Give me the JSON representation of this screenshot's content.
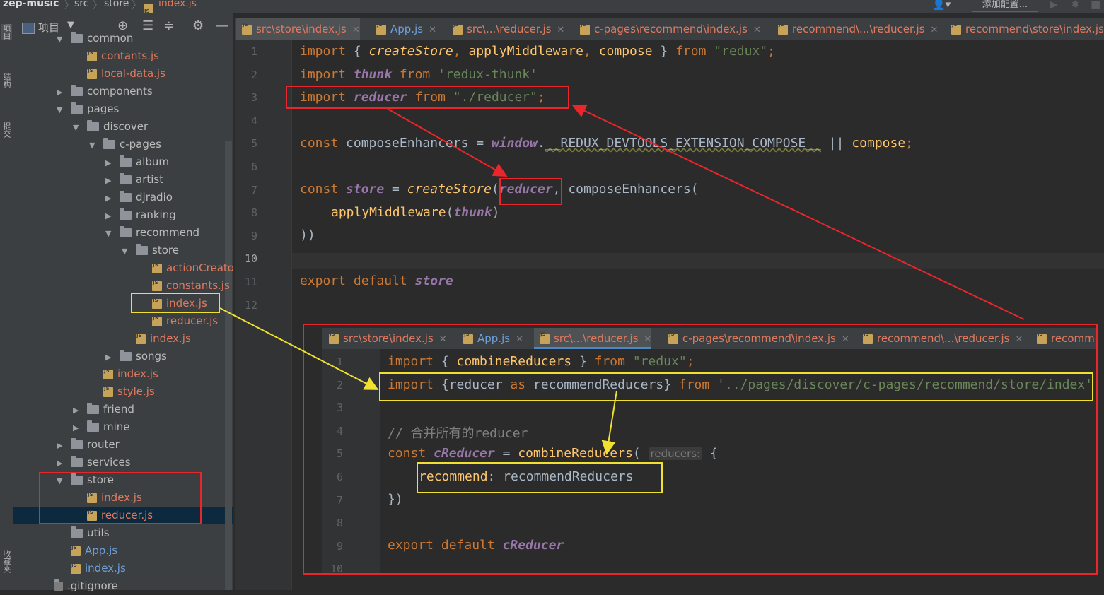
{
  "breadcrumb": {
    "project": "zep-music",
    "items": [
      "src",
      "store"
    ],
    "file": "index.js"
  },
  "toolbar": {
    "add_config": "添加配置..."
  },
  "left_strip": {
    "labels": [
      "项目",
      "结构",
      "提交",
      "收藏夹"
    ]
  },
  "panel": {
    "title": "项目",
    "tree": [
      {
        "label": "common",
        "type": "folder",
        "depth": 3,
        "state": "open"
      },
      {
        "label": "contants.js",
        "type": "js",
        "depth": 4
      },
      {
        "label": "local-data.js",
        "type": "js",
        "depth": 4
      },
      {
        "label": "components",
        "type": "folder",
        "depth": 3,
        "state": "closed"
      },
      {
        "label": "pages",
        "type": "folder",
        "depth": 3,
        "state": "open"
      },
      {
        "label": "discover",
        "type": "folder",
        "depth": 4,
        "state": "open"
      },
      {
        "label": "c-pages",
        "type": "folder",
        "depth": 5,
        "state": "open"
      },
      {
        "label": "album",
        "type": "folder",
        "depth": 6,
        "state": "closed"
      },
      {
        "label": "artist",
        "type": "folder",
        "depth": 6,
        "state": "closed"
      },
      {
        "label": "djradio",
        "type": "folder",
        "depth": 6,
        "state": "closed"
      },
      {
        "label": "ranking",
        "type": "folder",
        "depth": 6,
        "state": "closed"
      },
      {
        "label": "recommend",
        "type": "folder",
        "depth": 6,
        "state": "open"
      },
      {
        "label": "store",
        "type": "folder",
        "depth": 7,
        "state": "open"
      },
      {
        "label": "actionCreator",
        "type": "js",
        "depth": 8
      },
      {
        "label": "constants.js",
        "type": "js",
        "depth": 8
      },
      {
        "label": "index.js",
        "type": "js",
        "depth": 8
      },
      {
        "label": "reducer.js",
        "type": "js",
        "depth": 8
      },
      {
        "label": "index.js",
        "type": "js",
        "depth": 7
      },
      {
        "label": "songs",
        "type": "folder",
        "depth": 6,
        "state": "closed"
      },
      {
        "label": "index.js",
        "type": "js",
        "depth": 5
      },
      {
        "label": "style.js",
        "type": "js",
        "depth": 5
      },
      {
        "label": "friend",
        "type": "folder",
        "depth": 4,
        "state": "closed"
      },
      {
        "label": "mine",
        "type": "folder",
        "depth": 4,
        "state": "closed"
      },
      {
        "label": "router",
        "type": "folder",
        "depth": 3,
        "state": "closed"
      },
      {
        "label": "services",
        "type": "folder",
        "depth": 3,
        "state": "closed"
      },
      {
        "label": "store",
        "type": "folder",
        "depth": 3,
        "state": "open"
      },
      {
        "label": "index.js",
        "type": "js",
        "depth": 4
      },
      {
        "label": "reducer.js",
        "type": "js",
        "depth": 4,
        "selected": true
      },
      {
        "label": "utils",
        "type": "folder",
        "depth": 3,
        "state": "none"
      },
      {
        "label": "App.js",
        "type": "js-blue",
        "depth": 3
      },
      {
        "label": "index.js",
        "type": "js-blue",
        "depth": 3
      },
      {
        "label": ".gitignore",
        "type": "file",
        "depth": 2
      }
    ]
  },
  "editor": {
    "tabs": [
      {
        "label": "src\\store\\index.js",
        "active": true
      },
      {
        "label": "App.js",
        "blue": true
      },
      {
        "label": "src\\...\\reducer.js"
      },
      {
        "label": "c-pages\\recommend\\index.js"
      },
      {
        "label": "recommend\\...\\reducer.js"
      },
      {
        "label": "recommend\\store\\index.js"
      }
    ],
    "line_numbers": [
      "1",
      "2",
      "3",
      "4",
      "5",
      "6",
      "7",
      "8",
      "9",
      "10",
      "11",
      "12"
    ],
    "code": {
      "l1_import": "import",
      "l1_open": " { ",
      "l1_createStore": "createStore",
      "l1_comma1": ", ",
      "l1_applyMiddleware": "applyMiddleware",
      "l1_comma2": ", ",
      "l1_compose": "compose",
      "l1_close": " } ",
      "l1_from": "from",
      "l1_redux": " \"redux\"",
      "l1_semi": ";",
      "l2_import": "import",
      "l2_thunk": " thunk",
      "l2_from": " from",
      "l2_mod": " 'redux-thunk'",
      "l3_import": "import",
      "l3_reducer": " reducer",
      "l3_from": " from",
      "l3_mod": " \"./reducer\"",
      "l3_semi": ";",
      "l5_const": "const",
      "l5_name": " composeEnhancers = ",
      "l5_window": "window",
      "l5_dot": ".",
      "l5_ext": "__REDUX_DEVTOOLS_EXTENSION_COMPOSE__",
      "l5_or": " || ",
      "l5_compose": "compose",
      "l5_semi": ";",
      "l7_const": "const",
      "l7_store": " store",
      "l7_eq": " = ",
      "l7_createStore": "createStore",
      "l7_open": "(",
      "l7_reducer": "reducer",
      "l7_rest": ", composeEnhancers(",
      "l8_apply": "applyMiddleware",
      "l8_open": "(",
      "l8_thunk": "thunk",
      "l8_close": ")",
      "l9_close": "))",
      "l11_export": "export default",
      "l11_store": " store"
    }
  },
  "inset": {
    "tabs": [
      {
        "label": "src\\store\\index.js"
      },
      {
        "label": "App.js",
        "blue": true
      },
      {
        "label": "src\\...\\reducer.js",
        "active": true
      },
      {
        "label": "c-pages\\recommend\\index.js"
      },
      {
        "label": "recommend\\...\\reducer.js"
      },
      {
        "label": "recomm"
      }
    ],
    "line_numbers": [
      "1",
      "2",
      "3",
      "4",
      "5",
      "6",
      "7",
      "8",
      "9",
      "10"
    ],
    "code": {
      "l1_import": "import",
      "l1_mid": " { ",
      "l1_combine": "combineReducers",
      "l1_close": " } ",
      "l1_from": "from",
      "l1_redux": " \"redux\"",
      "l1_semi": ";",
      "l2_import": "import",
      "l2_open": " {",
      "l2_reducer": "reducer",
      "l2_as": " as",
      "l2_alias": " recommendReducers",
      "l2_close": "}",
      "l2_from": " from",
      "l2_path": " '../pages/discover/c-pages/recommend/store/index'",
      "l4_comment": "// 合并所有的reducer",
      "l5_const": "const",
      "l5_name": " cReducer",
      "l5_eq": " = ",
      "l5_combine": "combineReducers",
      "l5_open": "(",
      "l5_hint": "reducers:",
      "l5_brace": " {",
      "l6_key": "recommend",
      "l6_val": ": recommendReducers",
      "l7_close": "})",
      "l9_export": "export default",
      "l9_name": " cReducer"
    }
  },
  "colors": {
    "annotation_red": "#e8262b",
    "annotation_yellow": "#f0e130",
    "keyword": "#cc7832",
    "function": "#ffc66d",
    "string": "#6a8759",
    "variable_italic": "#9876aa"
  }
}
